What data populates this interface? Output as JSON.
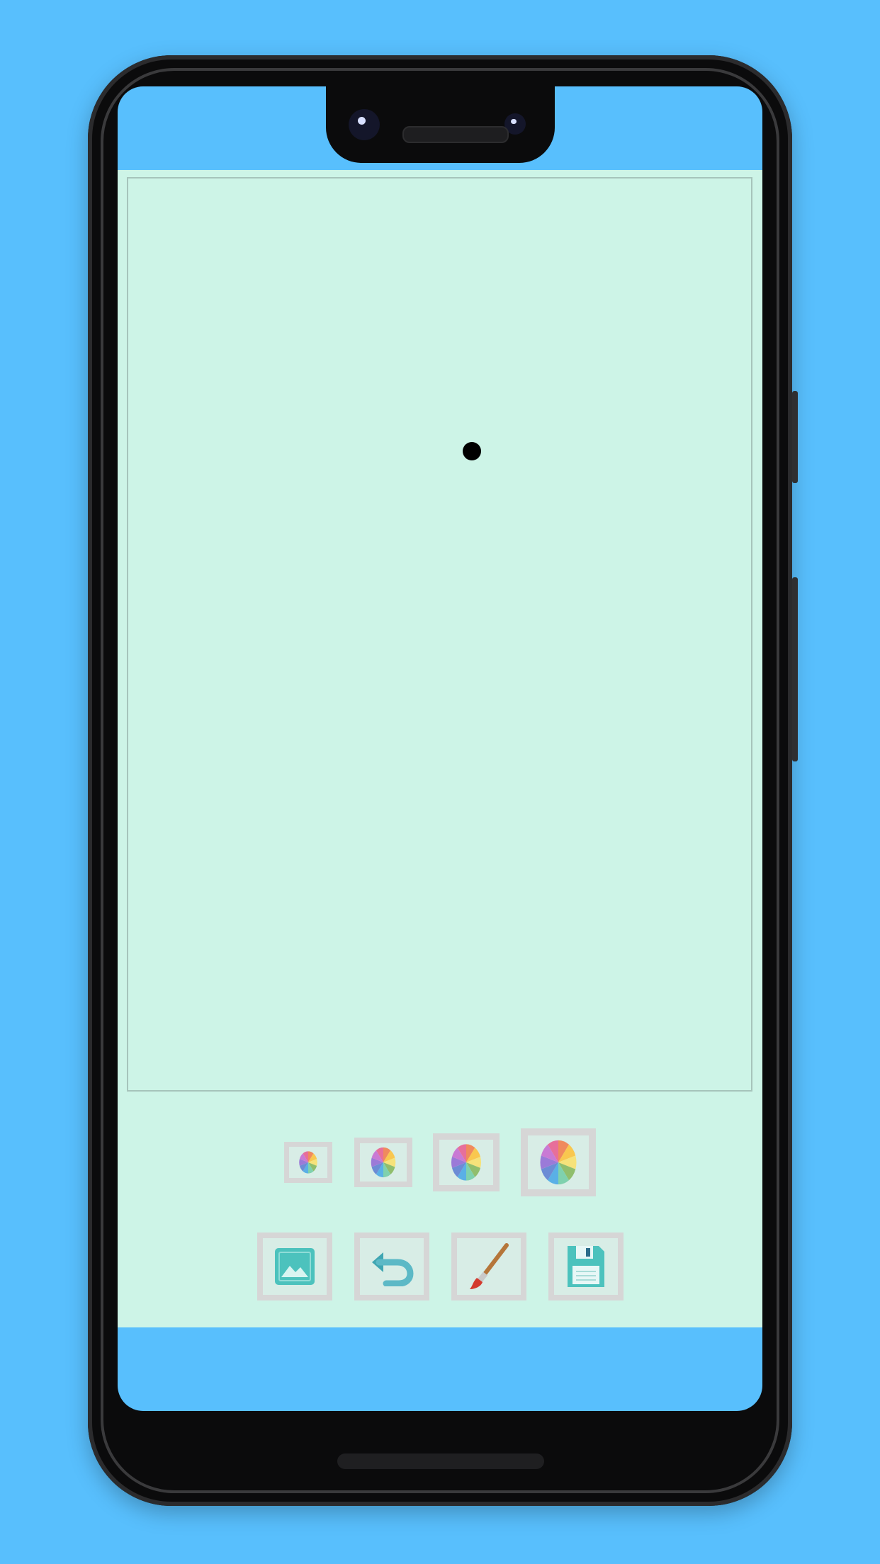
{
  "app": {
    "background_color": "#cdf4e7",
    "status_bar_color": "#58bffd"
  },
  "canvas": {
    "stroke_color": "#000000"
  },
  "brush_sizes": [
    {
      "name": "brush-size-small-button",
      "icon": "color-wheel-icon"
    },
    {
      "name": "brush-size-medium-button",
      "icon": "color-wheel-icon"
    },
    {
      "name": "brush-size-large-button",
      "icon": "color-wheel-icon"
    },
    {
      "name": "brush-size-xlarge-button",
      "icon": "color-wheel-icon"
    }
  ],
  "tools": [
    {
      "name": "image-button",
      "icon": "image-icon"
    },
    {
      "name": "undo-button",
      "icon": "undo-icon"
    },
    {
      "name": "brush-button",
      "icon": "paintbrush-icon"
    },
    {
      "name": "save-button",
      "icon": "floppy-disk-icon"
    }
  ]
}
